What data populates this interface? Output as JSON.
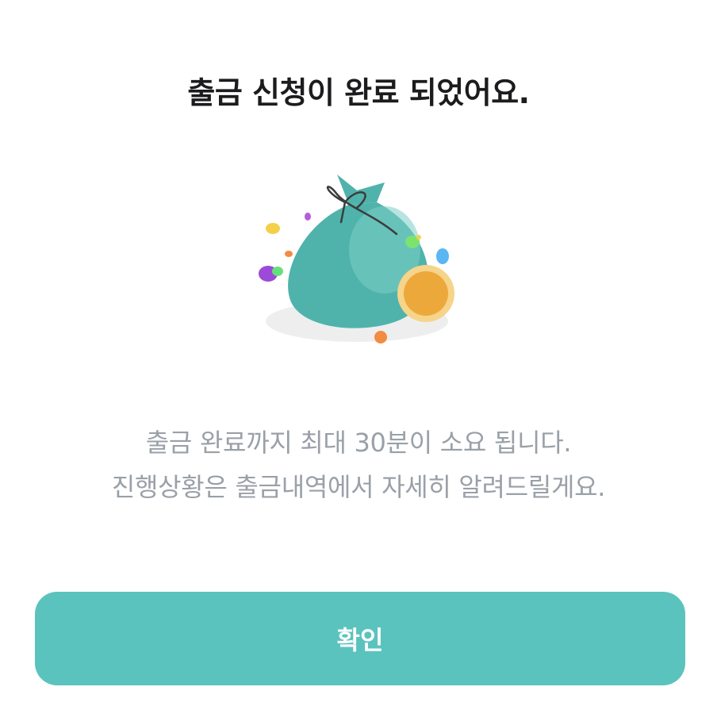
{
  "dialog": {
    "title": "출금 신청이 완료 되었어요.",
    "illustration_icon": "money-bag-icon",
    "message_lines": [
      "출금 완료까지 최대 30분이 소요 됩니다.",
      "진행상황은 출금내역에서 자세히 알려드릴게요."
    ],
    "confirm_label": "확인"
  },
  "colors": {
    "accent": "#5bc3bd",
    "bag": "#4fb3ab",
    "coin": "#f0b04a",
    "title": "#1c1c1e",
    "message": "#9aa0a8"
  }
}
